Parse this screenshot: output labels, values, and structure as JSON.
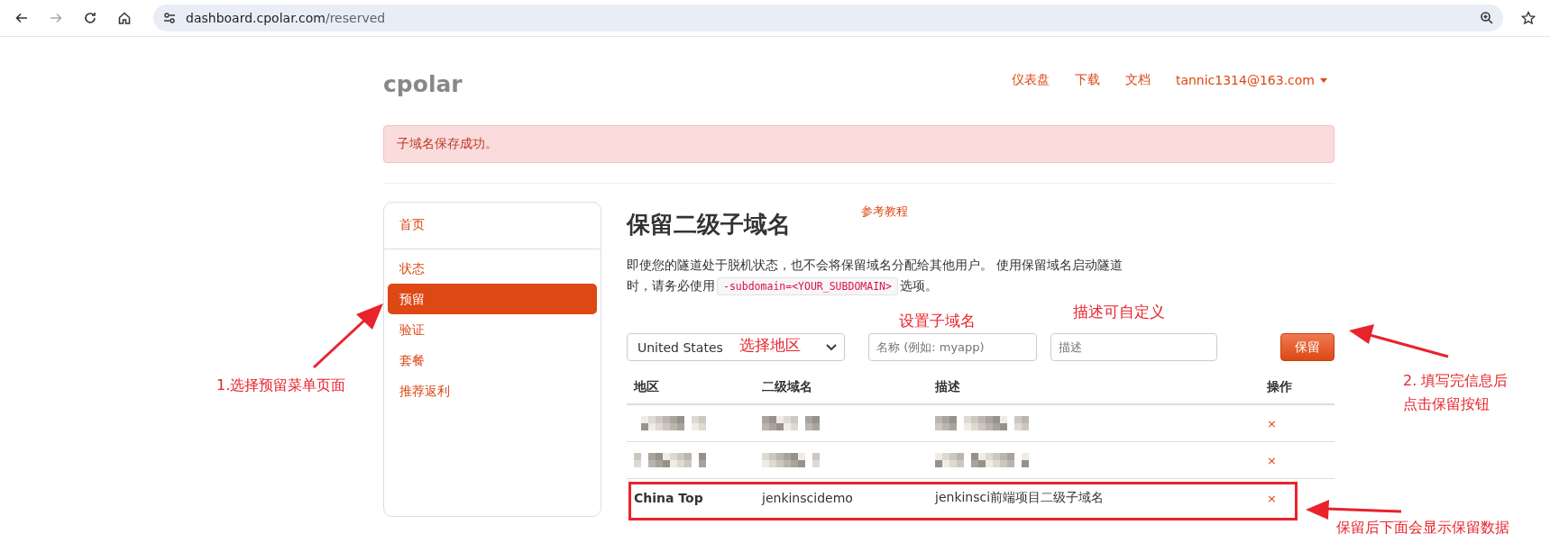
{
  "browser": {
    "url_host": "dashboard.cpolar.com",
    "url_path": "/reserved",
    "forward_enabled": false
  },
  "nav": {
    "logo": "cpolar",
    "links": [
      {
        "label": "仪表盘"
      },
      {
        "label": "下载"
      },
      {
        "label": "文档"
      }
    ],
    "account": "tannic1314@163.com"
  },
  "alert": "子域名保存成功。",
  "sidebar": {
    "groups": [
      [
        {
          "label": "首页",
          "selected": false
        }
      ],
      [
        {
          "label": "状态",
          "selected": false
        },
        {
          "label": "预留",
          "selected": true
        },
        {
          "label": "验证",
          "selected": false
        },
        {
          "label": "套餐",
          "selected": false
        },
        {
          "label": "推荐返利",
          "selected": false
        }
      ]
    ]
  },
  "page": {
    "title": "保留二级子域名",
    "tutorial_link": "参考教程",
    "description_before": "即使您的隧道处于脱机状态，也不会将保留域名分配给其他用户。 使用保留域名启动隧道时，请务必使用",
    "code": "-subdomain=<YOUR_SUBDOMAIN>",
    "description_after": "选项。"
  },
  "form": {
    "region": "United States",
    "name_placeholder": "名称 (例如: myapp)",
    "description_placeholder": "描述",
    "submit": "保留"
  },
  "table": {
    "columns": [
      "地区",
      "二级域名",
      "描述",
      "操作"
    ],
    "rows": [
      {
        "kind": "redacted",
        "action": "×",
        "highlighted": false
      },
      {
        "kind": "redacted",
        "action": "×",
        "highlighted": false
      },
      {
        "kind": "entry",
        "region": "China Top",
        "subdomain": "jenkinscidemo",
        "description": "jenkinsci前端项目二级子域名",
        "action": "×",
        "highlighted": true
      }
    ]
  },
  "annotations": {
    "region_hint": "选择地区",
    "subdomain_hint": "设置子域名",
    "description_hint": "描述可自定义",
    "menu_hint": "1.选择预留菜单页面",
    "button_hint": [
      "2. 填写完信息后",
      "点击保留按钮"
    ],
    "result_hint": "保留后下面会显示保留数据"
  }
}
